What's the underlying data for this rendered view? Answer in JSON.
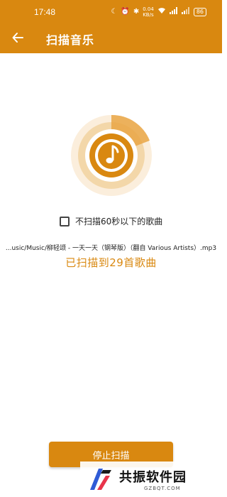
{
  "status_bar": {
    "time": "17:48",
    "net_speed_top": "0.04",
    "net_speed_unit": "KB/s",
    "battery": "86"
  },
  "app_bar": {
    "back_icon": "arrow-left-icon",
    "title": "扫描音乐"
  },
  "scan": {
    "icon": "music-note-icon",
    "skip_short_label": "不扫描60秒以下的歌曲",
    "skip_short_checked": false,
    "current_path": "...usic/Music/柳轻颂 - 一天一天（钢琴版）（翻自 Various Artists）.mp3",
    "status_text": "已扫描到29首歌曲"
  },
  "actions": {
    "stop_label": "停止扫描"
  },
  "watermark": {
    "name": "共振软件园",
    "url": "GZBQT.COM"
  },
  "colors": {
    "accent": "#d98810",
    "accent_light": "#f3d7a9",
    "accent_pale": "#fbeedc"
  }
}
